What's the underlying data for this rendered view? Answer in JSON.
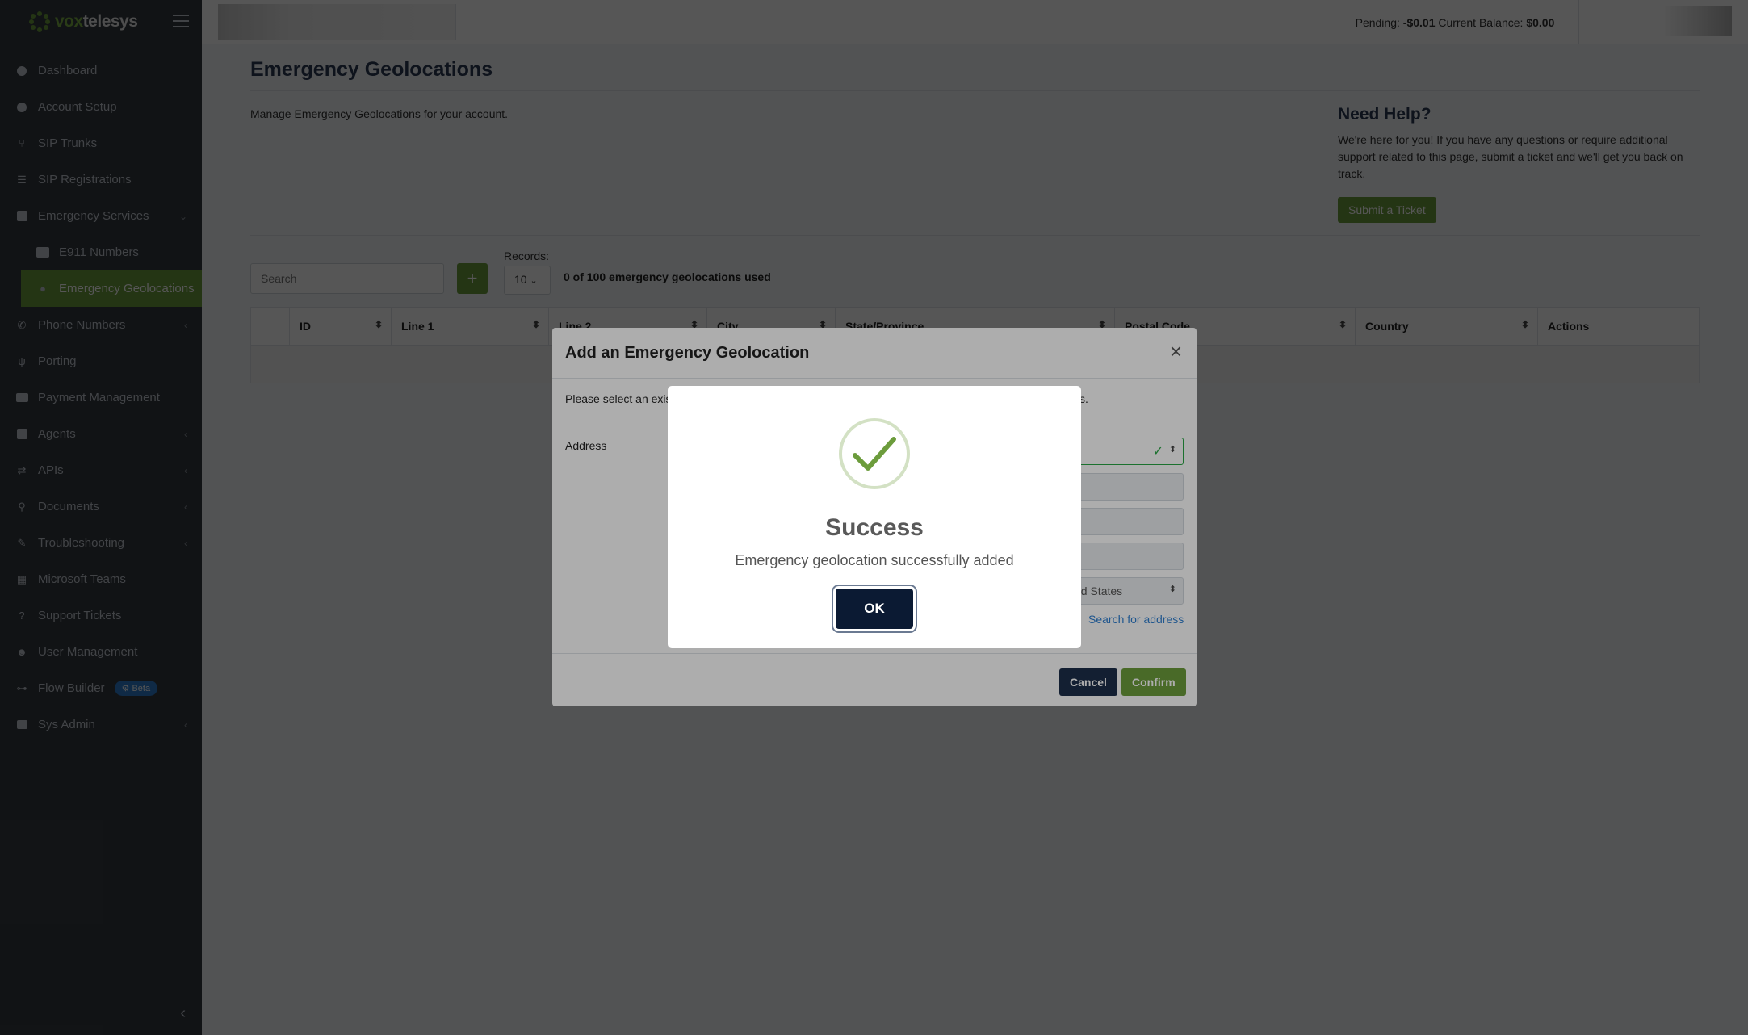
{
  "brand": {
    "name_prefix": "vox",
    "name_suffix": "telesys"
  },
  "topbar": {
    "pending_label": "Pending:",
    "pending_value": "-$0.01",
    "balance_label": "Current Balance:",
    "balance_value": "$0.00"
  },
  "sidebar": {
    "items": [
      {
        "label": "Dashboard",
        "icon": "dashboard-icon"
      },
      {
        "label": "Account Setup",
        "icon": "user-circle-icon"
      },
      {
        "label": "SIP Trunks",
        "icon": "branch-icon"
      },
      {
        "label": "SIP Registrations",
        "icon": "list-icon"
      },
      {
        "label": "Emergency Services",
        "icon": "medkit-icon"
      },
      {
        "label": "E911 Numbers",
        "icon": "ambulance-icon"
      },
      {
        "label": "Emergency Geolocations",
        "icon": "map-marker-icon"
      },
      {
        "label": "Phone Numbers",
        "icon": "phone-icon"
      },
      {
        "label": "Porting",
        "icon": "plug-icon"
      },
      {
        "label": "Payment Management",
        "icon": "credit-card-icon"
      },
      {
        "label": "Agents",
        "icon": "briefcase-icon"
      },
      {
        "label": "APIs",
        "icon": "exchange-icon"
      },
      {
        "label": "Documents",
        "icon": "search-icon"
      },
      {
        "label": "Troubleshooting",
        "icon": "wrench-icon"
      },
      {
        "label": "Microsoft Teams",
        "icon": "windows-icon"
      },
      {
        "label": "Support Tickets",
        "icon": "question-icon"
      },
      {
        "label": "User Management",
        "icon": "users-icon"
      },
      {
        "label": "Flow Builder",
        "icon": "sitemap-icon",
        "badge": "Beta"
      },
      {
        "label": "Sys Admin",
        "icon": "lock-icon"
      }
    ]
  },
  "page": {
    "title": "Emergency Geolocations",
    "description": "Manage Emergency Geolocations for your account.",
    "help_title": "Need Help?",
    "help_text": "We're here for you! If you have any questions or require additional support related to this page, submit a ticket and we'll get you back on track.",
    "ticket_button": "Submit a Ticket",
    "search_placeholder": "Search",
    "add_button": "+",
    "records_label": "Records:",
    "records_value": "10",
    "used_text": "0 of 100 emergency geolocations used",
    "table_headers": [
      "ID",
      "Line 1",
      "Line 2",
      "City",
      "State/Province",
      "Postal Code",
      "Country",
      "Actions"
    ]
  },
  "modal": {
    "title": "Add an Emergency Geolocation",
    "close": "×",
    "desc_start": "Please select an exis",
    "desc_end": "ss.",
    "address_label": "Address",
    "country_value": "ed States",
    "search_link": "Search for address",
    "cancel": "Cancel",
    "confirm": "Confirm"
  },
  "alert": {
    "title": "Success",
    "text": "Emergency geolocation successfully added",
    "ok": "OK"
  },
  "colors": {
    "accent": "#6c9c3c",
    "sidebar": "#343a40",
    "primary_dark": "#1c2e4a",
    "link": "#2f7fd1"
  }
}
